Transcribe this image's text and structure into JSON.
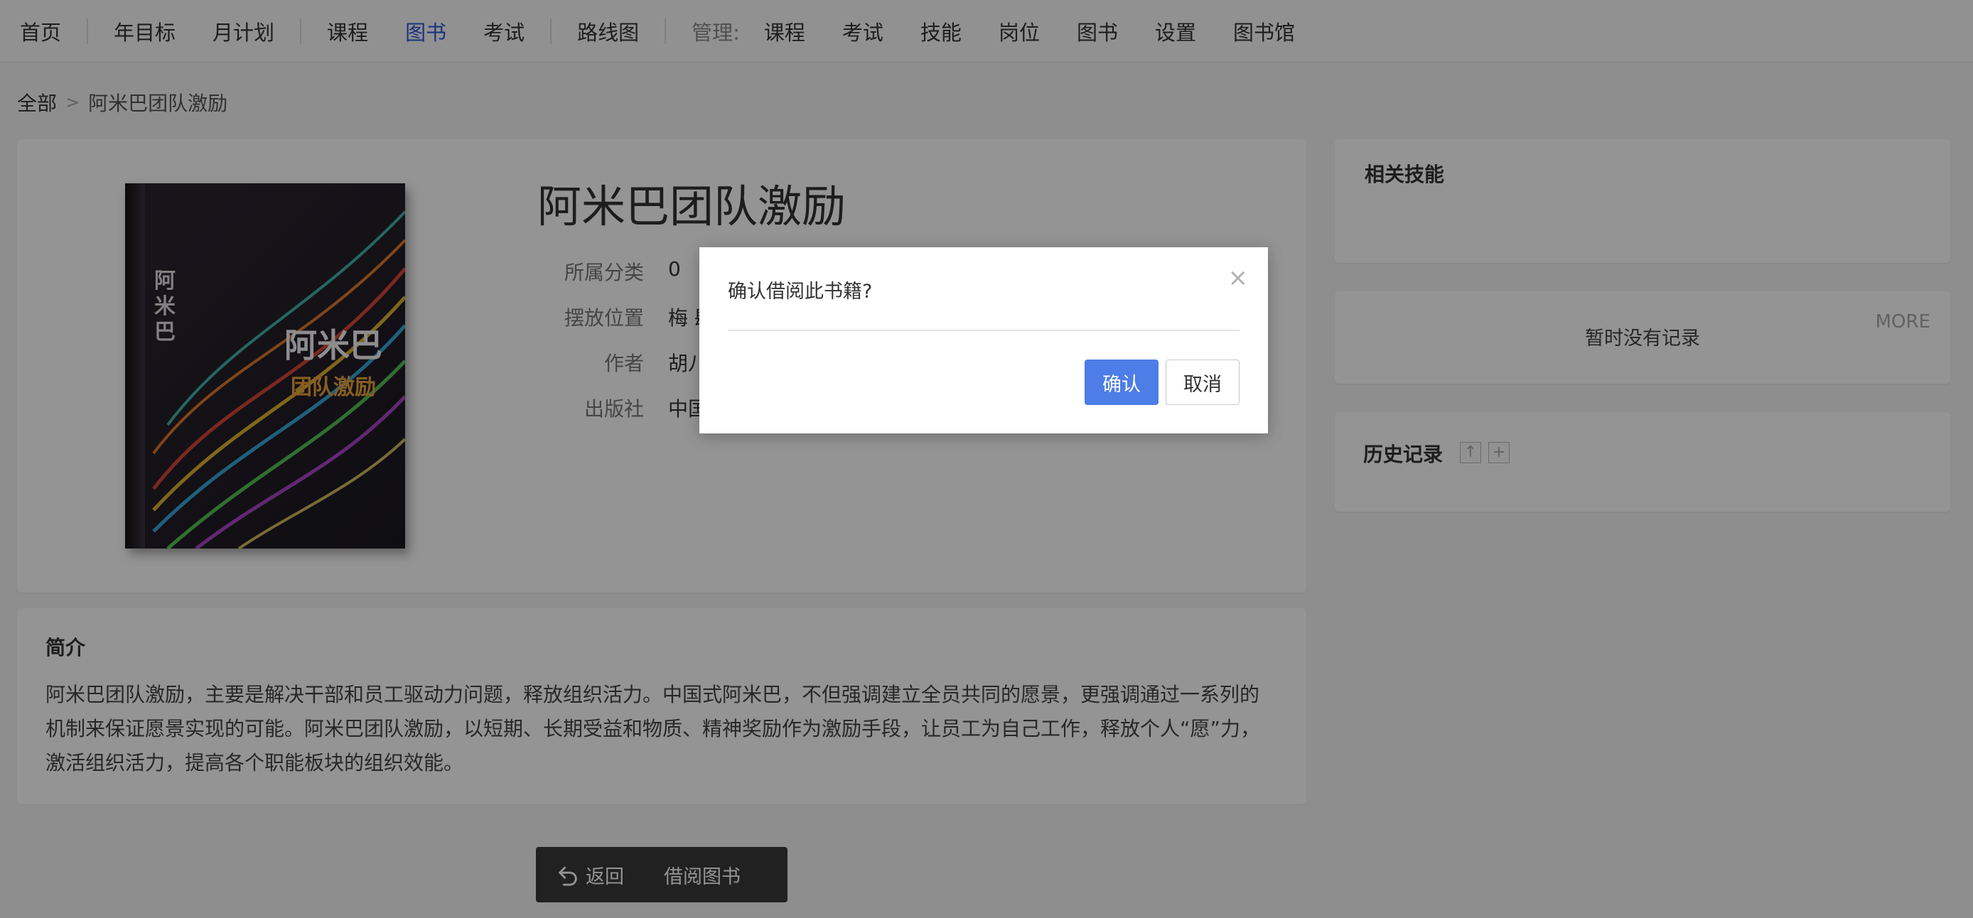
{
  "nav": {
    "items": [
      "首页",
      "年目标",
      "月计划",
      "课程",
      "图书",
      "考试",
      "路线图"
    ],
    "active_index": 4,
    "manage_label": "管理:",
    "manage_items": [
      "课程",
      "考试",
      "技能",
      "岗位",
      "图书",
      "设置",
      "图书馆"
    ]
  },
  "breadcrumb": {
    "root": "全部",
    "separator": ">",
    "current": "阿米巴团队激励"
  },
  "book": {
    "title": "阿米巴团队激励",
    "cover_title": "阿米巴",
    "cover_subtitle": "团队激励",
    "meta": [
      {
        "label": "所属分类",
        "value": "0"
      },
      {
        "label": "摆放位置",
        "value": "梅 肆"
      },
      {
        "label": "作者",
        "value": "胡八一"
      },
      {
        "label": "出版社",
        "value": "中国经"
      }
    ]
  },
  "intro": {
    "title": "简介",
    "text": "阿米巴团队激励，主要是解决干部和员工驱动力问题，释放组织活力。中国式阿米巴，不但强调建立全员共同的愿景，更强调通过一系列的机制来保证愿景实现的可能。阿米巴团队激励，以短期、长期受益和物质、精神奖励作为激励手段，让员工为自己工作，释放个人“愿”力，激活组织活力，提高各个职能板块的组织效能。"
  },
  "sidebar": {
    "skills_title": "相关技能",
    "no_record": "暂时没有记录",
    "more": "MORE",
    "history_title": "历史记录",
    "history_icons": [
      "↑",
      "+"
    ]
  },
  "actions": {
    "back": "返回",
    "borrow": "借阅图书"
  },
  "modal": {
    "message": "确认借阅此书籍?",
    "close": "×",
    "confirm": "确认",
    "cancel": "取消"
  },
  "colors": {
    "accent": "#4d7de6",
    "nav_active": "#2b58d8",
    "overlay": "rgba(0,0,0,0.42)"
  }
}
